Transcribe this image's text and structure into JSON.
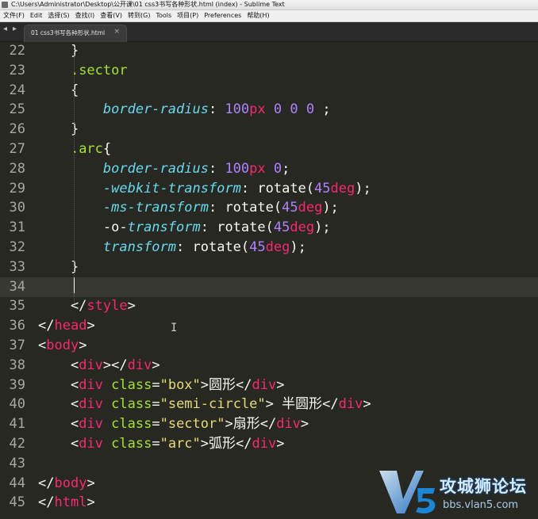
{
  "window": {
    "title": "C:\\Users\\Administrator\\Desktop\\公开课\\01 css3书写各种形状.html (index) - Sublime Text"
  },
  "menu": [
    {
      "label": "文件(F)",
      "name": "menu-file"
    },
    {
      "label": "Edit",
      "name": "menu-edit"
    },
    {
      "label": "选择(S)",
      "name": "menu-selection"
    },
    {
      "label": "查找(I)",
      "name": "menu-find"
    },
    {
      "label": "查看(V)",
      "name": "menu-view"
    },
    {
      "label": "转到(G)",
      "name": "menu-goto"
    },
    {
      "label": "Tools",
      "name": "menu-tools"
    },
    {
      "label": "项目(P)",
      "name": "menu-project"
    },
    {
      "label": "Preferences",
      "name": "menu-preferences"
    },
    {
      "label": "帮助(H)",
      "name": "menu-help"
    }
  ],
  "tabs": [
    {
      "label": "01 css3书写各种形状.html",
      "close": "×"
    }
  ],
  "nav_arrows": {
    "left": "◂",
    "right": "▸"
  },
  "editor": {
    "active_line": 34,
    "colors": {
      "background": "#272822",
      "keyword": "#f92672",
      "property": "#66d9ef",
      "number": "#ae81ff",
      "string": "#e6db74",
      "selector": "#a6e22e"
    },
    "lines": [
      {
        "n": "22",
        "tokens": [
          [
            "plain",
            "    }"
          ]
        ]
      },
      {
        "n": "23",
        "tokens": [
          [
            "plain",
            "    "
          ],
          [
            "sel",
            ".sector"
          ]
        ]
      },
      {
        "n": "24",
        "tokens": [
          [
            "plain",
            "    {"
          ]
        ]
      },
      {
        "n": "25",
        "tokens": [
          [
            "plain",
            "        "
          ],
          [
            "prop",
            "border-radius"
          ],
          [
            "plain",
            ": "
          ],
          [
            "num",
            "100"
          ],
          [
            "unit",
            "px"
          ],
          [
            "plain",
            " "
          ],
          [
            "num",
            "0"
          ],
          [
            "plain",
            " "
          ],
          [
            "num",
            "0"
          ],
          [
            "plain",
            " "
          ],
          [
            "num",
            "0"
          ],
          [
            "plain",
            " ;"
          ]
        ]
      },
      {
        "n": "26",
        "tokens": [
          [
            "plain",
            "    }"
          ]
        ]
      },
      {
        "n": "27",
        "tokens": [
          [
            "plain",
            "    "
          ],
          [
            "sel",
            ".arc"
          ],
          [
            "plain",
            "{"
          ]
        ]
      },
      {
        "n": "28",
        "tokens": [
          [
            "plain",
            "        "
          ],
          [
            "prop",
            "border-radius"
          ],
          [
            "plain",
            ": "
          ],
          [
            "num",
            "100"
          ],
          [
            "unit",
            "px"
          ],
          [
            "plain",
            " "
          ],
          [
            "num",
            "0"
          ],
          [
            "plain",
            ";"
          ]
        ]
      },
      {
        "n": "29",
        "tokens": [
          [
            "plain",
            "        "
          ],
          [
            "prop",
            "-webkit-transform"
          ],
          [
            "plain",
            ": "
          ],
          [
            "fn",
            "rotate"
          ],
          [
            "plain",
            "("
          ],
          [
            "num",
            "45"
          ],
          [
            "unit",
            "deg"
          ],
          [
            "plain",
            ");"
          ]
        ]
      },
      {
        "n": "30",
        "tokens": [
          [
            "plain",
            "        "
          ],
          [
            "prop",
            "-ms-transform"
          ],
          [
            "plain",
            ": "
          ],
          [
            "fn",
            "rotate"
          ],
          [
            "plain",
            "("
          ],
          [
            "num",
            "45"
          ],
          [
            "unit",
            "deg"
          ],
          [
            "plain",
            ");"
          ]
        ]
      },
      {
        "n": "31",
        "tokens": [
          [
            "plain",
            "        -o-"
          ],
          [
            "prop",
            "transform"
          ],
          [
            "plain",
            ": "
          ],
          [
            "fn",
            "rotate"
          ],
          [
            "plain",
            "("
          ],
          [
            "num",
            "45"
          ],
          [
            "unit",
            "deg"
          ],
          [
            "plain",
            ");"
          ]
        ]
      },
      {
        "n": "32",
        "tokens": [
          [
            "plain",
            "        "
          ],
          [
            "prop",
            "transform"
          ],
          [
            "plain",
            ": "
          ],
          [
            "fn",
            "rotate"
          ],
          [
            "plain",
            "("
          ],
          [
            "num",
            "45"
          ],
          [
            "unit",
            "deg"
          ],
          [
            "plain",
            ");"
          ]
        ]
      },
      {
        "n": "33",
        "tokens": [
          [
            "plain",
            "    }"
          ]
        ]
      },
      {
        "n": "34",
        "tokens": [
          [
            "plain",
            ""
          ]
        ]
      },
      {
        "n": "35",
        "tokens": [
          [
            "plain",
            "    </"
          ],
          [
            "tag",
            "style"
          ],
          [
            "plain",
            ">"
          ]
        ]
      },
      {
        "n": "36",
        "tokens": [
          [
            "plain",
            "</"
          ],
          [
            "tag",
            "head"
          ],
          [
            "plain",
            ">"
          ]
        ]
      },
      {
        "n": "37",
        "tokens": [
          [
            "plain",
            "<"
          ],
          [
            "tag",
            "body"
          ],
          [
            "plain",
            ">"
          ]
        ]
      },
      {
        "n": "38",
        "tokens": [
          [
            "plain",
            "    <"
          ],
          [
            "tag",
            "div"
          ],
          [
            "plain",
            "></"
          ],
          [
            "tag",
            "div"
          ],
          [
            "plain",
            ">"
          ]
        ]
      },
      {
        "n": "39",
        "tokens": [
          [
            "plain",
            "    <"
          ],
          [
            "tag",
            "div"
          ],
          [
            "plain",
            " "
          ],
          [
            "attr",
            "class"
          ],
          [
            "plain",
            "="
          ],
          [
            "str",
            "\"box\""
          ],
          [
            "plain",
            ">圆形</"
          ],
          [
            "tag",
            "div"
          ],
          [
            "plain",
            ">"
          ]
        ]
      },
      {
        "n": "40",
        "tokens": [
          [
            "plain",
            "    <"
          ],
          [
            "tag",
            "div"
          ],
          [
            "plain",
            " "
          ],
          [
            "attr",
            "class"
          ],
          [
            "plain",
            "="
          ],
          [
            "str",
            "\"semi-circle\""
          ],
          [
            "plain",
            "> 半圆形</"
          ],
          [
            "tag",
            "div"
          ],
          [
            "plain",
            ">"
          ]
        ]
      },
      {
        "n": "41",
        "tokens": [
          [
            "plain",
            "    <"
          ],
          [
            "tag",
            "div"
          ],
          [
            "plain",
            " "
          ],
          [
            "attr",
            "class"
          ],
          [
            "plain",
            "="
          ],
          [
            "str",
            "\"sector\""
          ],
          [
            "plain",
            ">扇形</"
          ],
          [
            "tag",
            "div"
          ],
          [
            "plain",
            ">"
          ]
        ]
      },
      {
        "n": "42",
        "tokens": [
          [
            "plain",
            "    <"
          ],
          [
            "tag",
            "div"
          ],
          [
            "plain",
            " "
          ],
          [
            "attr",
            "class"
          ],
          [
            "plain",
            "="
          ],
          [
            "str",
            "\"arc\""
          ],
          [
            "plain",
            ">弧形</"
          ],
          [
            "tag",
            "div"
          ],
          [
            "plain",
            ">"
          ]
        ]
      },
      {
        "n": "43",
        "tokens": [
          [
            "plain",
            ""
          ]
        ]
      },
      {
        "n": "44",
        "tokens": [
          [
            "plain",
            "</"
          ],
          [
            "tag",
            "body"
          ],
          [
            "plain",
            ">"
          ]
        ]
      },
      {
        "n": "45",
        "tokens": [
          [
            "plain",
            "</"
          ],
          [
            "tag",
            "html"
          ],
          [
            "plain",
            ">"
          ]
        ]
      }
    ]
  },
  "cursor": {
    "ibeam": "I"
  },
  "watermark": {
    "logo": "V5",
    "text": "攻城狮论坛",
    "url": "bbs.vlan5.com"
  }
}
